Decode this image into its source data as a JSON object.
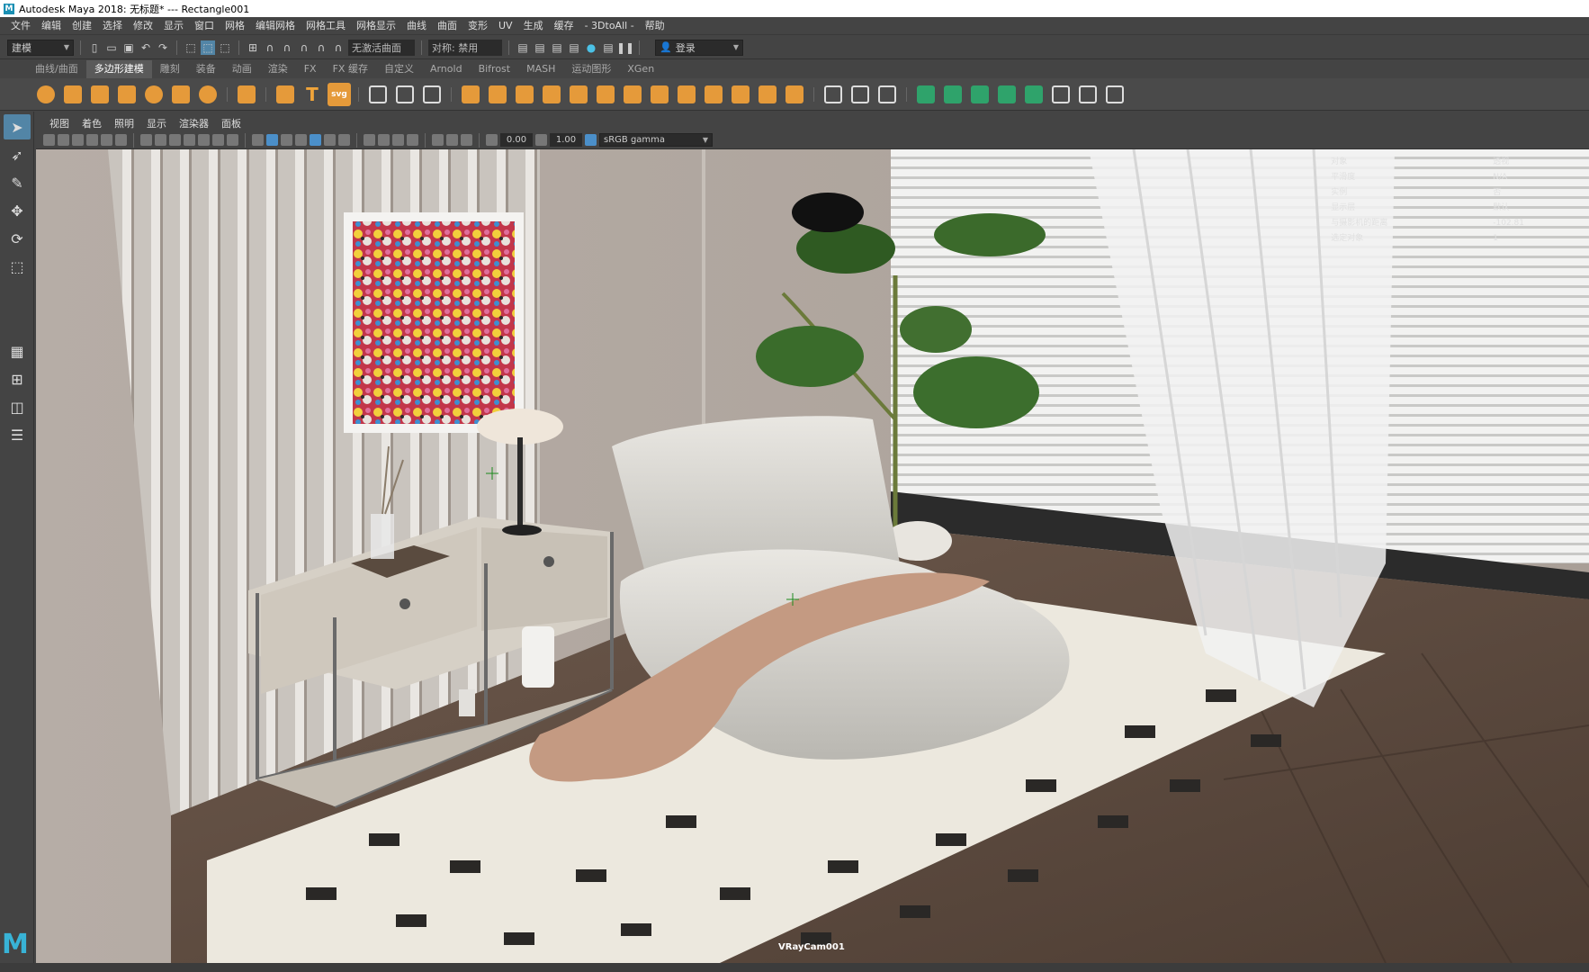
{
  "window": {
    "title": "Autodesk Maya 2018: 无标题*   ---   Rectangle001"
  },
  "menu": [
    "文件",
    "编辑",
    "创建",
    "选择",
    "修改",
    "显示",
    "窗口",
    "网格",
    "编辑网格",
    "网格工具",
    "网格显示",
    "曲线",
    "曲面",
    "变形",
    "UV",
    "生成",
    "缓存",
    "- 3DtoAll -",
    "帮助"
  ],
  "statusline": {
    "mode": "建模",
    "curve_field": "无激活曲面",
    "symmetry": "对称: 禁用",
    "login": "登录"
  },
  "shelf_tabs": [
    "曲线/曲面",
    "多边形建模",
    "雕刻",
    "装备",
    "动画",
    "渲染",
    "FX",
    "FX 缓存",
    "自定义",
    "Arnold",
    "Bifrost",
    "MASH",
    "运动图形",
    "XGen"
  ],
  "shelf_active": "多边形建模",
  "shelf_text_icons": {
    "text": "T",
    "svg": "svg"
  },
  "panel_menu": [
    "视图",
    "着色",
    "照明",
    "显示",
    "渲染器",
    "面板"
  ],
  "panel_tools": {
    "exposure": "0.00",
    "gamma": "1.00",
    "color_space": "sRGB gamma"
  },
  "hud": [
    {
      "k": "对象",
      "v": "透视"
    },
    {
      "k": "平滑度",
      "v": "N/A"
    },
    {
      "k": "实例",
      "v": "否"
    },
    {
      "k": "显示层",
      "v": "默认"
    },
    {
      "k": "与摄影机的距离",
      "v": "-102.81"
    },
    {
      "k": "选定对象",
      "v": "1"
    }
  ],
  "camera_label": "VRayCam001",
  "logo": "M",
  "colors": {
    "accent_blue": "#5285a6",
    "shelf_orange": "#e59a3a",
    "shelf_green": "#2fa36b",
    "maya_logo": "#38b3d6"
  }
}
